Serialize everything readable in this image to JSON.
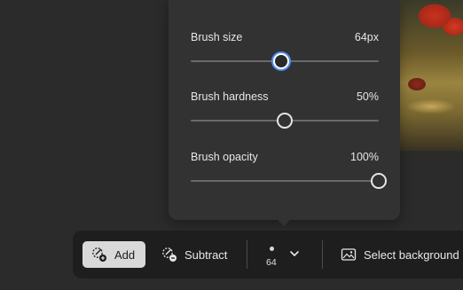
{
  "brush_panel": {
    "sliders": [
      {
        "label": "Brush size",
        "value_text": "64px",
        "fraction": 0.48
      },
      {
        "label": "Brush hardness",
        "value_text": "50%",
        "fraction": 0.5
      },
      {
        "label": "Brush opacity",
        "value_text": "100%",
        "fraction": 1.0
      }
    ]
  },
  "toolbar": {
    "add_label": "Add",
    "subtract_label": "Subtract",
    "brush_size_value": "64",
    "select_background_label": "Select background"
  },
  "colors": {
    "background": "#2b2b2b",
    "panel": "#323232",
    "toolbar": "#1e1e1e",
    "active_button": "#d9d9d9",
    "focus_ring": "#4d8ff0"
  },
  "icons": {
    "add": "brush-add-icon",
    "subtract": "brush-subtract-icon",
    "size_dropdown": "chevron-down-icon",
    "select_background": "image-icon"
  }
}
